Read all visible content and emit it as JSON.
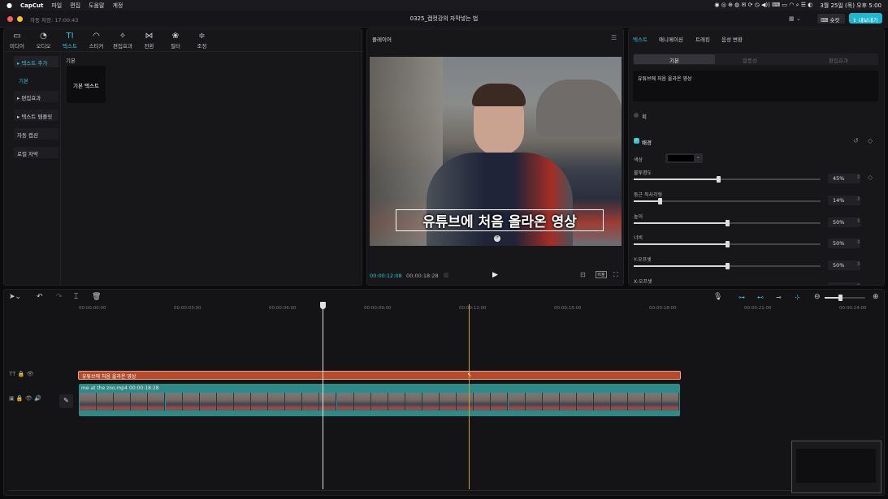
{
  "menubar": {
    "app_name": "CapCut",
    "items": [
      "파일",
      "편집",
      "도움말",
      "계정"
    ],
    "datetime": "3월 25일 (목) 오후 5:00"
  },
  "window": {
    "autosave": "자동 저장: 17:00:43",
    "project_title": "0325_캡컷강의 자막넣는 법",
    "shortcut_label": "숏컷",
    "export_label": "내보내기"
  },
  "toolbar": {
    "tools": [
      {
        "label": "미디어",
        "icon": "media-icon"
      },
      {
        "label": "오디오",
        "icon": "audio-icon"
      },
      {
        "label": "텍스트",
        "icon": "text-icon"
      },
      {
        "label": "스티커",
        "icon": "sticker-icon"
      },
      {
        "label": "편집효과",
        "icon": "effects-icon"
      },
      {
        "label": "전환",
        "icon": "transition-icon"
      },
      {
        "label": "필터",
        "icon": "filter-icon"
      },
      {
        "label": "조정",
        "icon": "adjust-icon"
      }
    ]
  },
  "sidebar": {
    "items": [
      "▸ 텍스트 추가",
      "기본",
      "▸ 편집효과",
      "▸ 텍스트 템플릿",
      "자동 캡션",
      "로컬 자막"
    ]
  },
  "library": {
    "section_title": "기본",
    "card_label": "기본 텍스트"
  },
  "player": {
    "title": "플레이어",
    "subtitle": "유튜브에 처음 올라온 영상",
    "current_time": "00:00:12:08",
    "total_time": "00:00:18:28",
    "ratio_label": "비율"
  },
  "inspector": {
    "tabs": [
      "텍스트",
      "애니메이션",
      "트래킹",
      "음성 변환"
    ],
    "subtabs": [
      "기본",
      "말풍선",
      "편집효과"
    ],
    "text_value": "유튜브에 처음 올라온 영상",
    "stroke_label": "획",
    "background_label": "배경",
    "color_label": "색상",
    "colors": {
      "accent": "#37c3d6",
      "clip_text": "#b84a2c",
      "clip_video": "#2e8a86",
      "playhead": "#e0e0e0",
      "marker": "#c9a227"
    },
    "params": [
      {
        "label": "불투명도",
        "value": "45%",
        "level": 0.45
      },
      {
        "label": "둥근 직사각형",
        "value": "14%",
        "level": 0.14
      },
      {
        "label": "높이",
        "value": "50%",
        "level": 0.5
      },
      {
        "label": "너비",
        "value": "50%",
        "level": 0.5
      },
      {
        "label": "Y-오프셋",
        "value": "50%",
        "level": 0.5
      },
      {
        "label": "X-오프셋",
        "value": "",
        "level": 0.5
      }
    ]
  },
  "timeline": {
    "ticks": [
      "00:00:00:00",
      "00:00:03:00",
      "00:00:06:00",
      "00:00:09:00",
      "00:00:12:00",
      "00:00:15:00",
      "00:00:18:00",
      "00:00:21:00",
      "00:00:24:00"
    ],
    "text_clip": "유튜브에 처음 올라온 영상",
    "video_clip_name": "me at the zoo.mp4",
    "video_clip_duration": "00:00:18:28"
  }
}
